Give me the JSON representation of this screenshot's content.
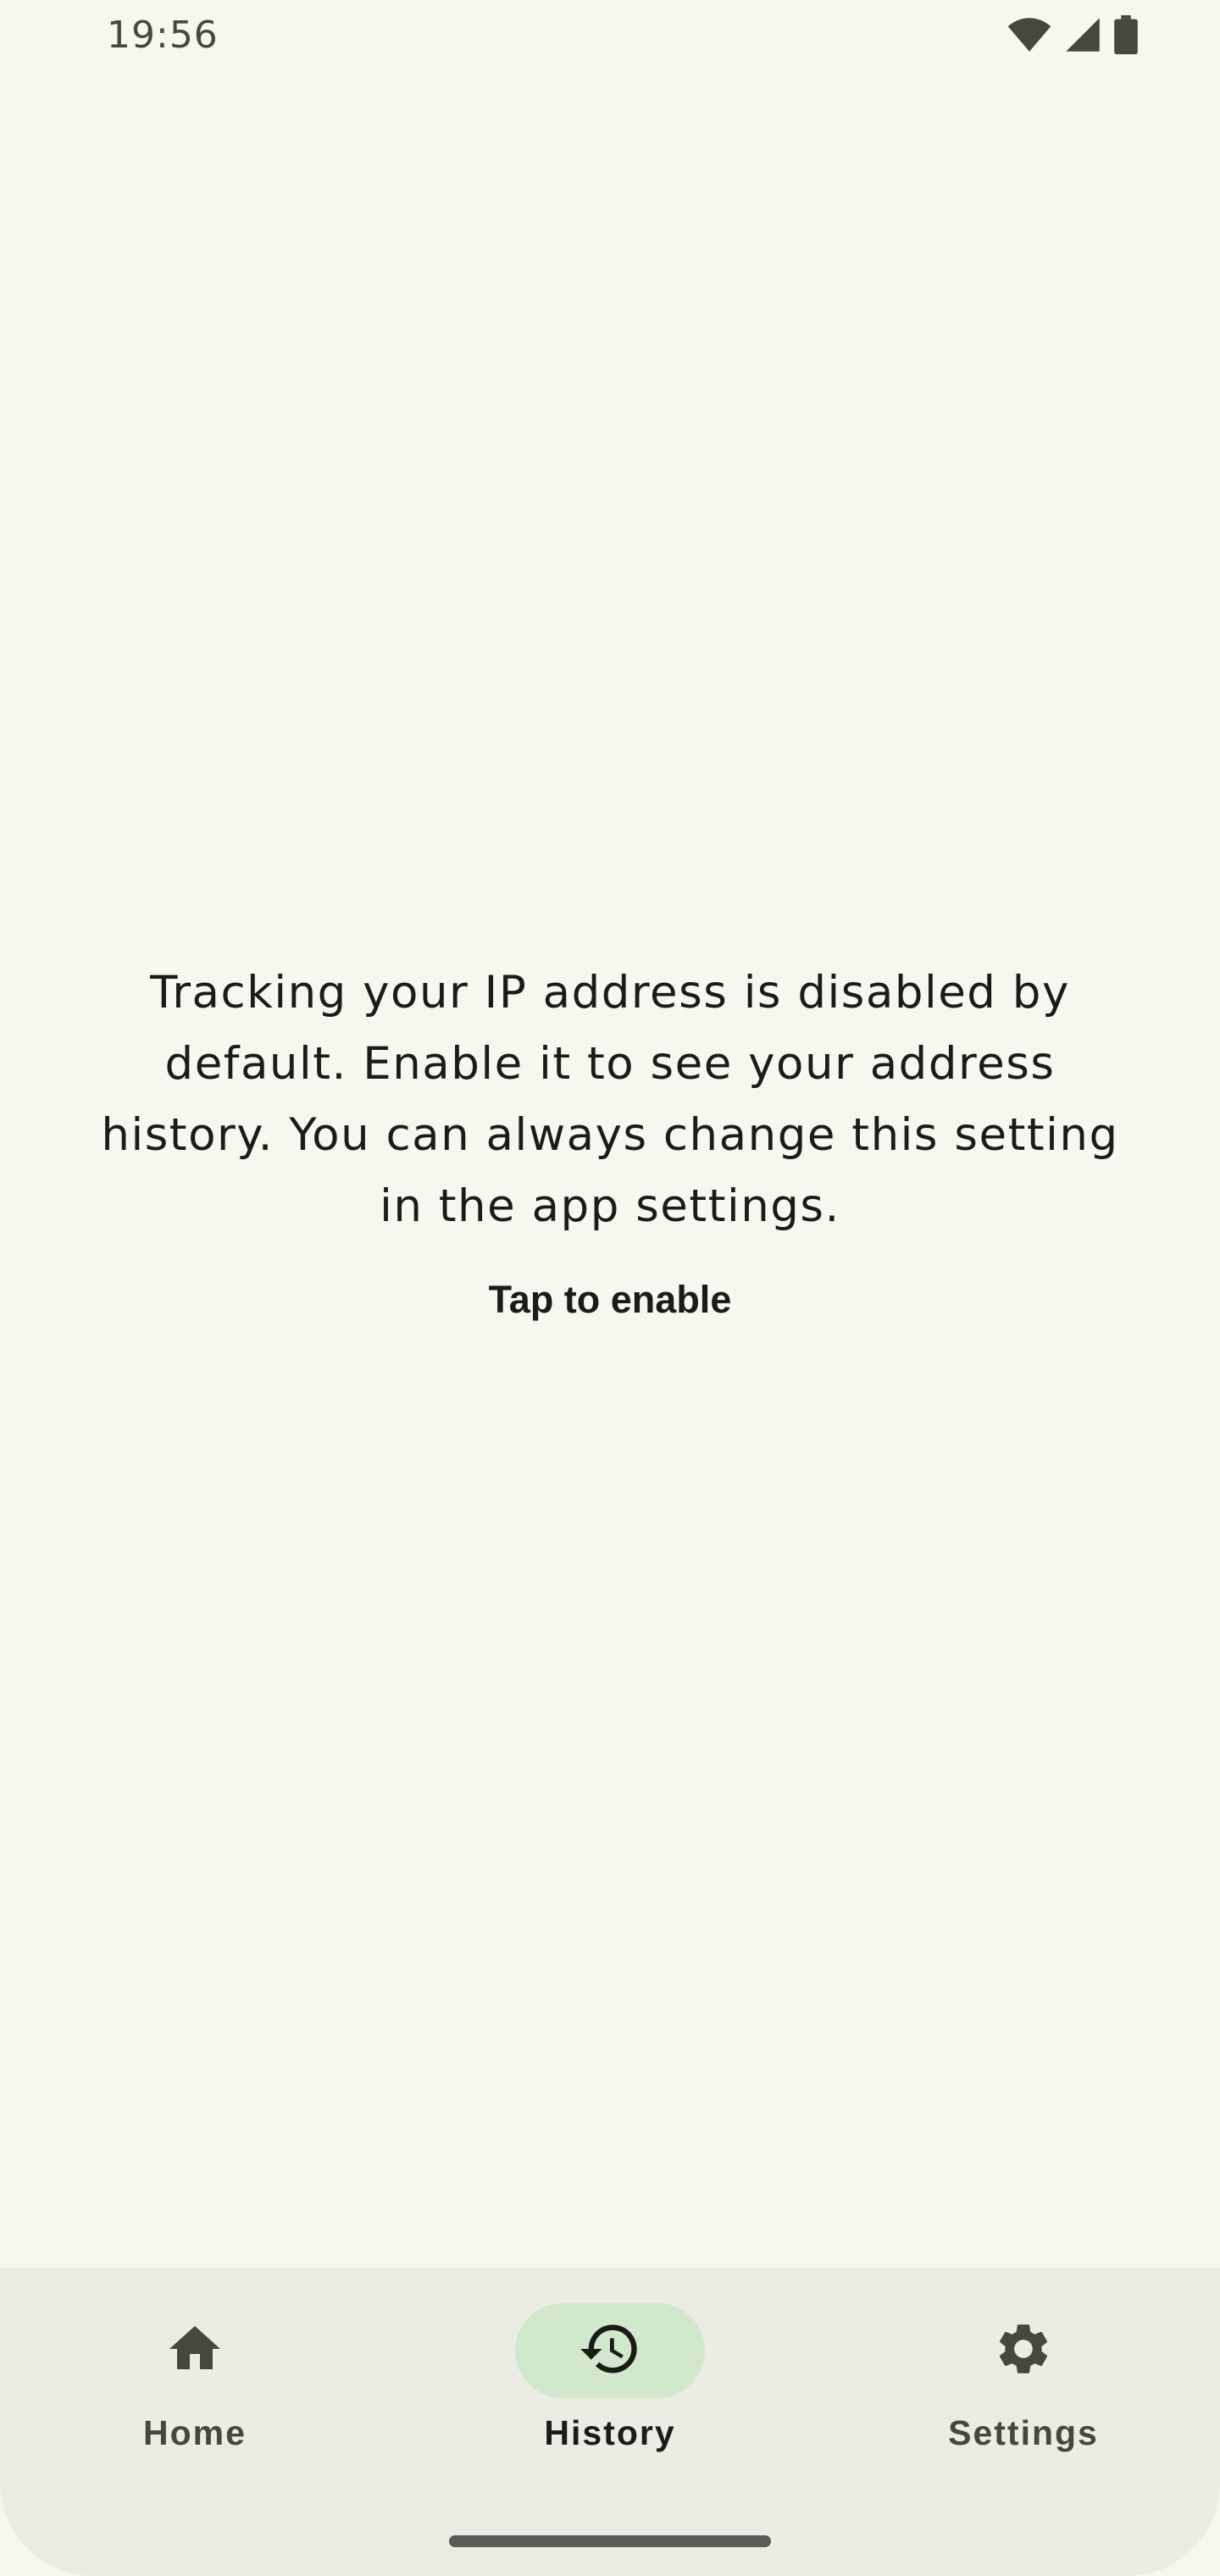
{
  "status_bar": {
    "time": "19:56",
    "icons": [
      "wifi-icon",
      "cell-signal-icon",
      "battery-icon"
    ]
  },
  "main": {
    "message": "Tracking your IP address is disabled by default. Enable it to see your address history. You can always change this setting in the app settings.",
    "enable_label": "Tap to enable"
  },
  "bottom_nav": {
    "items": [
      {
        "label": "Home",
        "icon": "home-icon",
        "active": false
      },
      {
        "label": "History",
        "icon": "history-icon",
        "active": true
      },
      {
        "label": "Settings",
        "icon": "gear-icon",
        "active": false
      }
    ]
  },
  "colors": {
    "background": "#f6f8f0",
    "nav_background": "#ebede5",
    "active_indicator": "#d1e8cd",
    "text": "#1a1c18",
    "icon": "#44483f"
  }
}
